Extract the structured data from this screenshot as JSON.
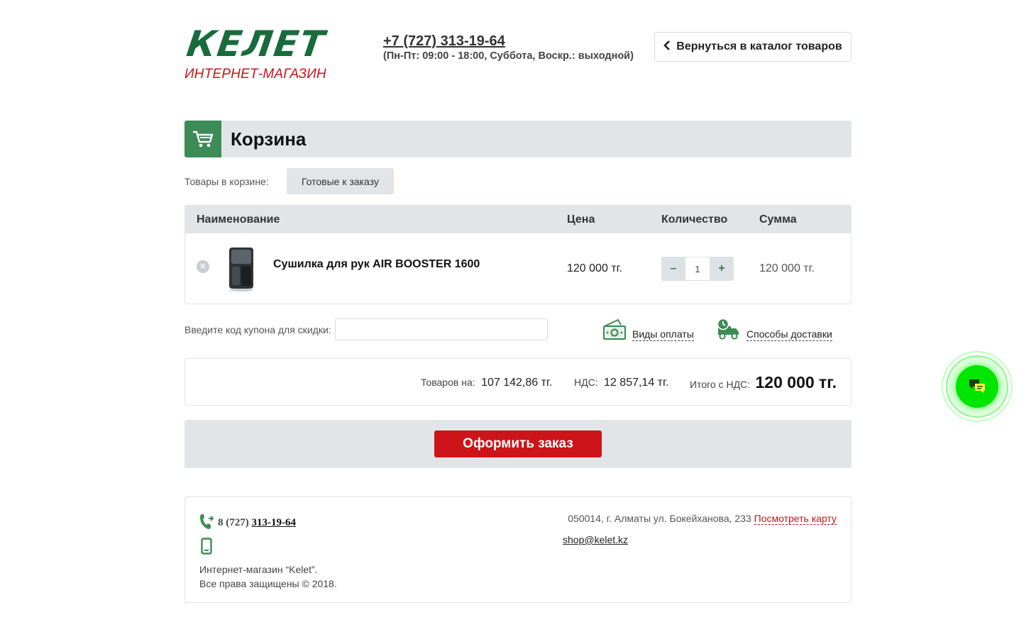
{
  "header": {
    "logo_word": "КЕЛЕТ",
    "logo_sub": "ИНТЕРНЕТ-МАГАЗИН",
    "phone": "+7 (727) 313-19-64",
    "hours": "(Пн-Пт: 09:00 - 18:00, Суббота, Воскр.: выходной)",
    "back_label": "Вернуться в каталог товаров"
  },
  "cart": {
    "title": "Корзина",
    "items_label": "Товары в корзине:",
    "tab_ready": "Готовые к заказу",
    "columns": {
      "name": "Наименование",
      "price": "Цена",
      "qty": "Количество",
      "sum": "Сумма"
    },
    "rows": [
      {
        "name": "Сушилка для рук AIR BOOSTER 1600",
        "price": "120 000 тг.",
        "qty": "1",
        "sum": "120 000 тг."
      }
    ]
  },
  "coupon": {
    "label": "Введите код купона для скидки:",
    "value": ""
  },
  "links": {
    "payment": "Виды оплаты",
    "delivery": "Способы доставки"
  },
  "totals": {
    "goods_label": "Товаров на:",
    "goods_value": "107 142,86 тг.",
    "vat_label": "НДС:",
    "vat_value": "12 857,14 тг.",
    "total_label": "Итого с НДС:",
    "total_value": "120 000 тг."
  },
  "order_button": "Оформить заказ",
  "footer": {
    "phone_prefix": "8 (727)",
    "phone_number": "313-19-64",
    "copy_line1": "Интернет-магазин “Kelet”.",
    "copy_line2": "Все права защищены © 2018.",
    "address": "050014, г. Алматы ул. Бокейханова, 233",
    "map_link": "Посмотреть карту",
    "email": "shop@kelet.kz"
  },
  "icons": {
    "cart": "cart-icon",
    "back": "chevron-left-icon",
    "remove": "close-circle-icon",
    "payment": "money-icon",
    "delivery": "truck-clock-icon",
    "phone": "phone-forward-icon",
    "mobile": "mobile-icon",
    "chat": "chat-bubbles-icon"
  },
  "colors": {
    "brand_green": "#1a6b3c",
    "accent_green": "#3d8b55",
    "brand_red": "#c8141b",
    "order_red": "#cc1419",
    "panel_gray": "#e1e5e8",
    "chat_green": "#00e600"
  }
}
